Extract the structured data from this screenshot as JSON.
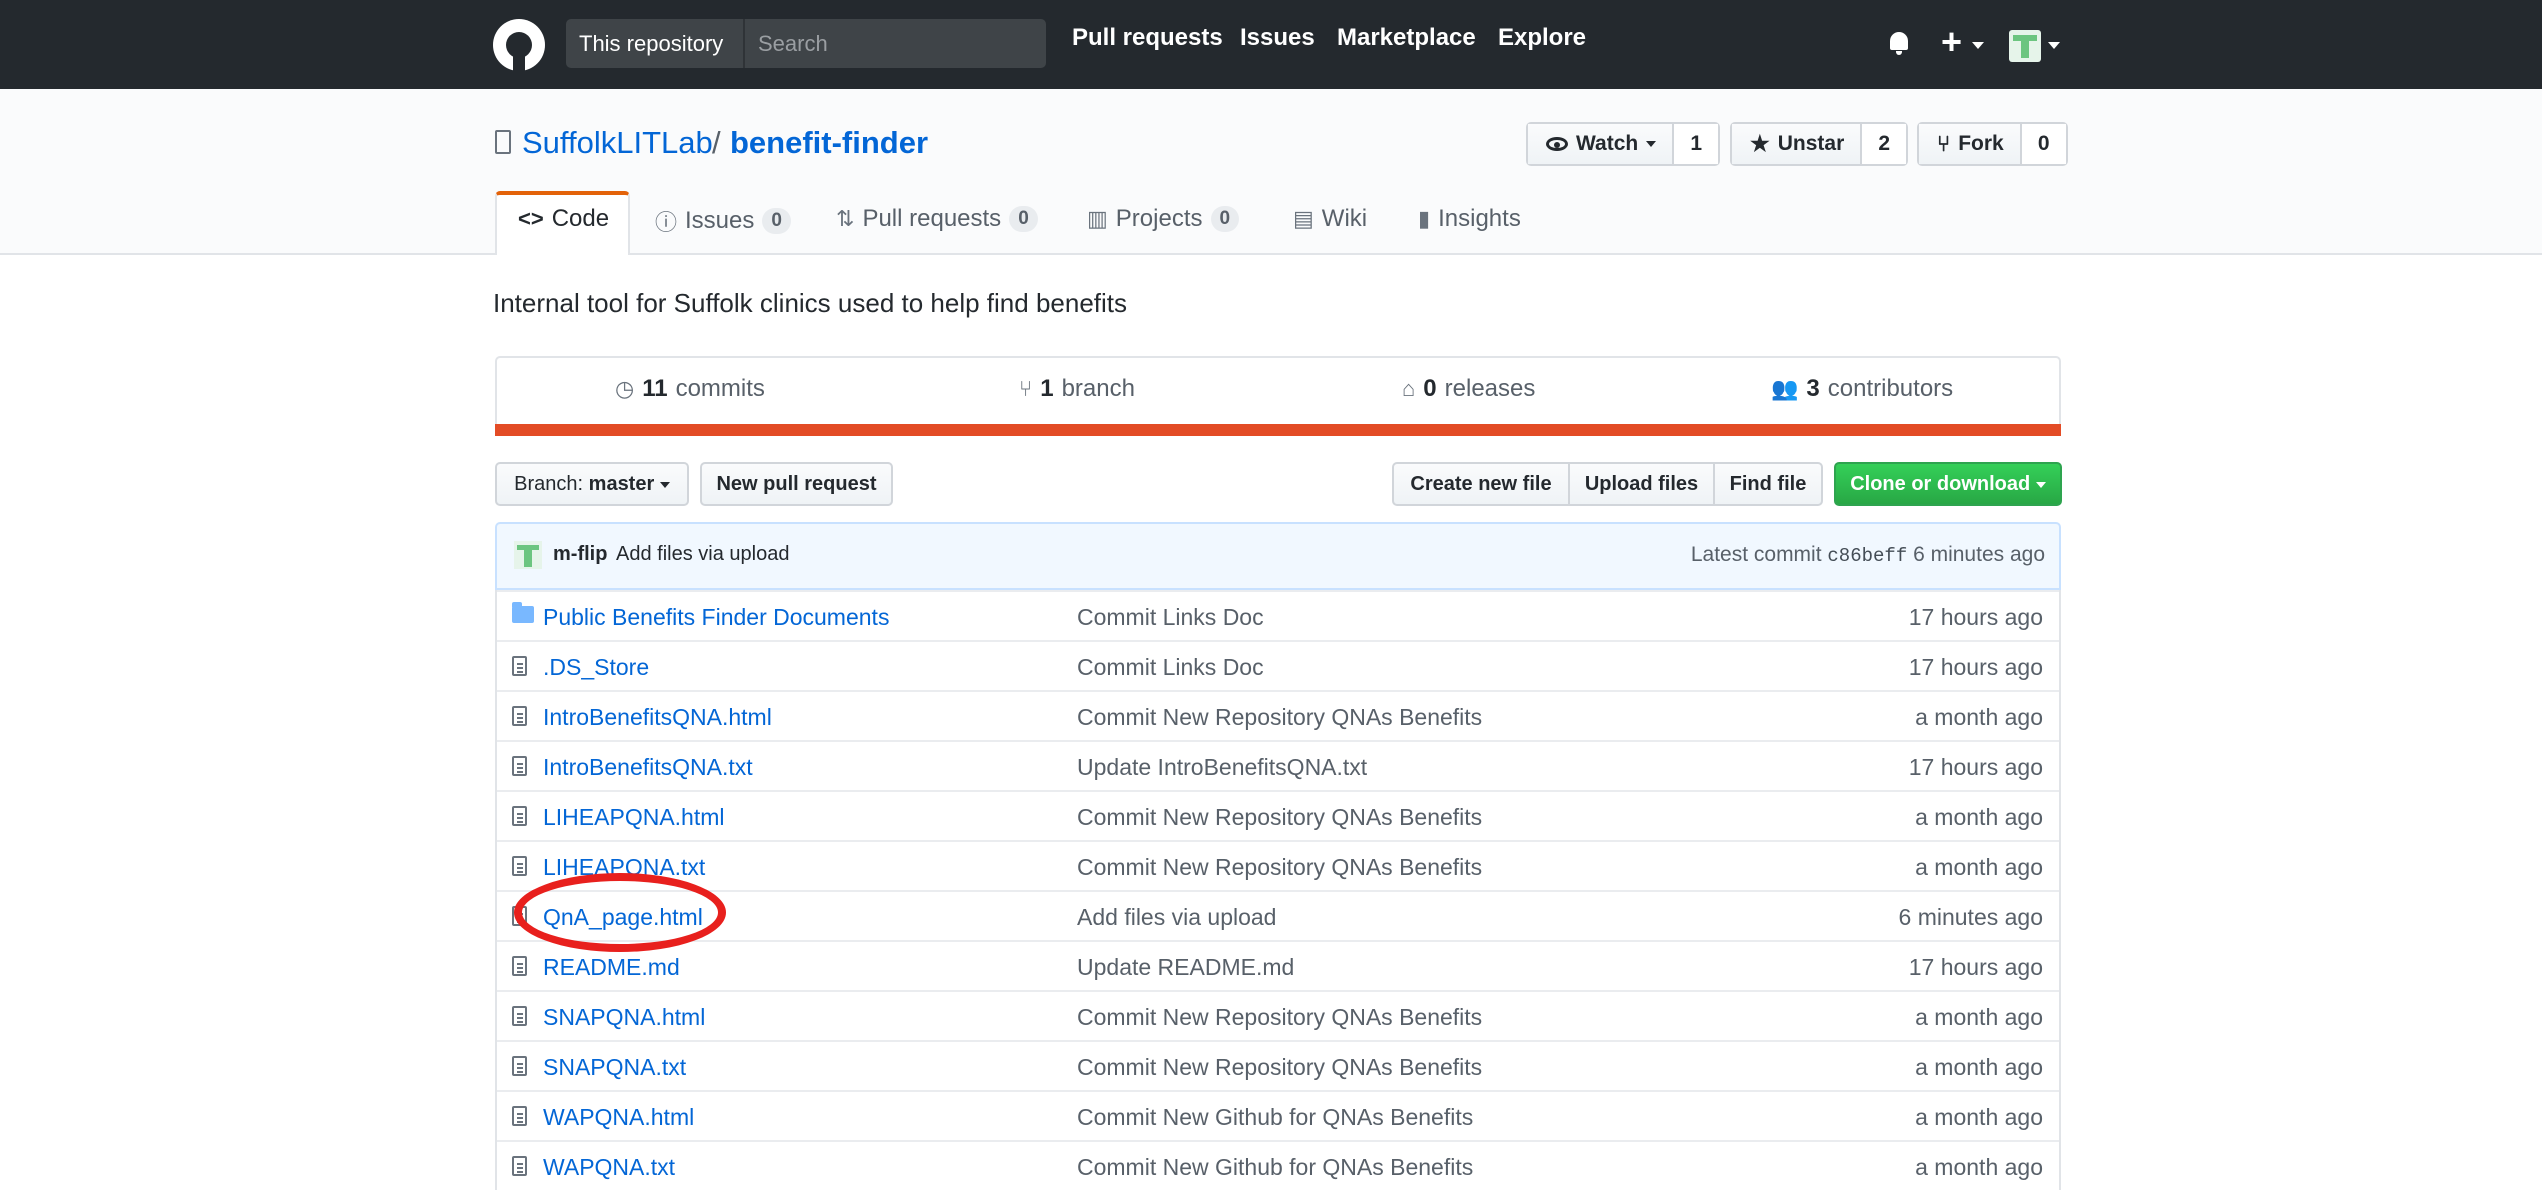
{
  "topnav": {
    "scope": "This repository",
    "search_placeholder": "Search",
    "links": [
      "Pull requests",
      "Issues",
      "Marketplace",
      "Explore"
    ],
    "plus": "+"
  },
  "repo": {
    "owner": "SuffolkLITLab",
    "separator": "/",
    "name": "benefit-finder",
    "watch_label": "Watch",
    "watch_count": "1",
    "star_label": "Unstar",
    "star_count": "2",
    "fork_label": "Fork",
    "fork_count": "0"
  },
  "tabs": [
    {
      "label": "Code",
      "count": null
    },
    {
      "label": "Issues",
      "count": "0"
    },
    {
      "label": "Pull requests",
      "count": "0"
    },
    {
      "label": "Projects",
      "count": "0"
    },
    {
      "label": "Wiki",
      "count": null
    },
    {
      "label": "Insights",
      "count": null
    }
  ],
  "description": "Internal tool for Suffolk clinics used to help find benefits",
  "stats": {
    "commits_num": "11",
    "commits_label": "commits",
    "branch_num": "1",
    "branch_label": "branch",
    "releases_num": "0",
    "releases_label": "releases",
    "contributors_num": "3",
    "contributors_label": "contributors"
  },
  "toolbar": {
    "branch_prefix": "Branch:",
    "branch_name": "master",
    "new_pr": "New pull request",
    "create_file": "Create new file",
    "upload": "Upload files",
    "find": "Find file",
    "clone": "Clone or download"
  },
  "latest_commit": {
    "author": "m-flip",
    "message": "Add files via upload",
    "prefix": "Latest commit",
    "sha": "c86beff",
    "age": "6 minutes ago"
  },
  "files": [
    {
      "type": "dir",
      "name": "Public Benefits Finder Documents",
      "message": "Commit Links Doc",
      "age": "17 hours ago"
    },
    {
      "type": "file",
      "name": ".DS_Store",
      "message": "Commit Links Doc",
      "age": "17 hours ago"
    },
    {
      "type": "file",
      "name": "IntroBenefitsQNA.html",
      "message": "Commit New Repository QNAs Benefits",
      "age": "a month ago"
    },
    {
      "type": "file",
      "name": "IntroBenefitsQNA.txt",
      "message": "Update IntroBenefitsQNA.txt",
      "age": "17 hours ago"
    },
    {
      "type": "file",
      "name": "LIHEAPQNA.html",
      "message": "Commit New Repository QNAs Benefits",
      "age": "a month ago"
    },
    {
      "type": "file",
      "name": "LIHEAPQNA.txt",
      "message": "Commit New Repository QNAs Benefits",
      "age": "a month ago"
    },
    {
      "type": "file",
      "name": "QnA_page.html",
      "message": "Add files via upload",
      "age": "6 minutes ago"
    },
    {
      "type": "file",
      "name": "README.md",
      "message": "Update README.md",
      "age": "17 hours ago"
    },
    {
      "type": "file",
      "name": "SNAPQNA.html",
      "message": "Commit New Repository QNAs Benefits",
      "age": "a month ago"
    },
    {
      "type": "file",
      "name": "SNAPQNA.txt",
      "message": "Commit New Repository QNAs Benefits",
      "age": "a month ago"
    },
    {
      "type": "file",
      "name": "WAPQNA.html",
      "message": "Commit New Github for QNAs Benefits",
      "age": "a month ago"
    },
    {
      "type": "file",
      "name": "WAPQNA.txt",
      "message": "Commit New Github for QNAs Benefits",
      "age": "a month ago"
    }
  ],
  "colors": {
    "nav_bg": "#24292e",
    "link": "#0366d6",
    "language_bar": "#e34c26",
    "primary_button": "#28a745",
    "annotation_circle": "#e8201d"
  }
}
